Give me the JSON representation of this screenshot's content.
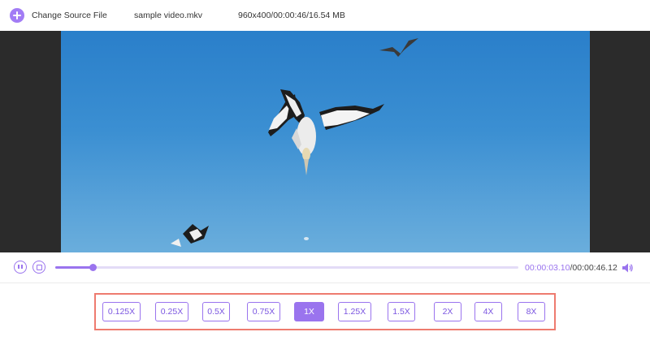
{
  "toolbar": {
    "change_source_label": "Change Source File",
    "file_name": "sample video.mkv",
    "file_info": "960x400/00:00:46/16.54 MB",
    "add_icon": "plus-circle-icon"
  },
  "player": {
    "current_time": "00:00:03.10",
    "separator": "/",
    "total_time": "00:00:46.12",
    "progress_fraction": 0.08,
    "pause_icon": "pause-icon",
    "stop_icon": "stop-icon",
    "volume_icon": "volume-icon"
  },
  "speeds": {
    "options": [
      "0.125X",
      "0.25X",
      "0.5X",
      "0.75X",
      "1X",
      "1.25X",
      "1.5X",
      "2X",
      "4X",
      "8X"
    ],
    "selected": "1X"
  },
  "colors": {
    "accent": "#9a74ee",
    "highlight_border": "#ee7b6f"
  }
}
